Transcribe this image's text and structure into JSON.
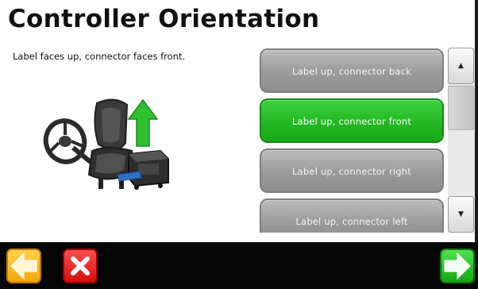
{
  "header": {
    "title": "Controller Orientation"
  },
  "description": "Label faces up, connector  faces front.",
  "illustration": {
    "icon": "seat-steering-controller-illustration"
  },
  "options": [
    {
      "label": "Label up, connector back",
      "selected": false
    },
    {
      "label": "Label up, connector front",
      "selected": true
    },
    {
      "label": "Label up, connector right",
      "selected": false
    },
    {
      "label": "Label up, connector left",
      "selected": false
    }
  ],
  "scrollbar": {
    "up_glyph": "▲",
    "down_glyph": "▼"
  },
  "footer": {
    "back_icon": "arrow-left-icon",
    "cancel_icon": "close-icon",
    "next_icon": "arrow-right-icon"
  },
  "colors": {
    "selected": "#22b822",
    "unselected": "#9a9a9a",
    "back": "#f3a60a",
    "cancel": "#d40f0f",
    "next": "#17a817"
  }
}
